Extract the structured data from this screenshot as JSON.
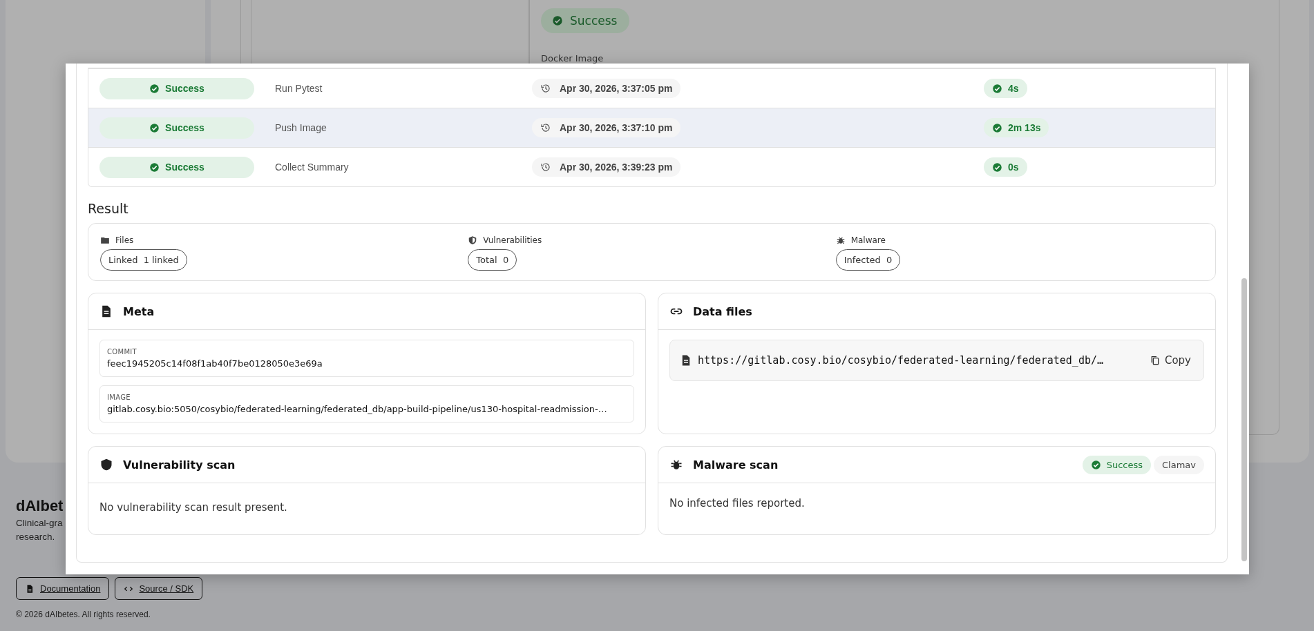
{
  "background": {
    "status_chip": "Success",
    "docker_label": "Docker Image"
  },
  "footer": {
    "brand": "dAIbet",
    "tagline": [
      "Clinical-gra",
      "research."
    ],
    "links": [
      {
        "label": "Documentation"
      },
      {
        "label": "Source / SDK"
      }
    ],
    "copyright": "© 2026 dAIbetes. All rights reserved."
  },
  "steps": [
    {
      "status": "Success",
      "name": "Run Pytest",
      "time": "Apr 30, 2026, 3:37:05 pm",
      "duration": "4s",
      "highlighted": false
    },
    {
      "status": "Success",
      "name": "Push Image",
      "time": "Apr 30, 2026, 3:37:10 pm",
      "duration": "2m 13s",
      "highlighted": true
    },
    {
      "status": "Success",
      "name": "Collect Summary",
      "time": "Apr 30, 2026, 3:39:23 pm",
      "duration": "0s",
      "highlighted": false
    }
  ],
  "result": {
    "title": "Result",
    "items": [
      {
        "kind": "files",
        "label": "Files",
        "chip_label": "Linked",
        "chip_value": "1 linked"
      },
      {
        "kind": "vulnerabilities",
        "label": "Vulnerabilities",
        "chip_label": "Total",
        "chip_value": "0"
      },
      {
        "kind": "malware",
        "label": "Malware",
        "chip_label": "Infected",
        "chip_value": "0"
      }
    ]
  },
  "meta": {
    "title": "Meta",
    "fields": [
      {
        "label": "COMMIT",
        "value": "feec1945205c14f08f1ab40f7be0128050e3e69a"
      },
      {
        "label": "IMAGE",
        "value": "gitlab.cosy.bio:5050/cosybio/federated-learning/federated_db/app-build-pipeline/us130-hospital-readmission-…"
      }
    ]
  },
  "data_files": {
    "title": "Data files",
    "files": [
      {
        "url": "https://gitlab.cosy.bio/cosybio/federated-learning/federated_db/…",
        "action": "Copy"
      }
    ]
  },
  "vulnerability_scan": {
    "title": "Vulnerability scan",
    "message": "No vulnerability scan result present."
  },
  "malware_scan": {
    "title": "Malware scan",
    "status": "Success",
    "engine": "Clamav",
    "message": "No infected files reported."
  }
}
